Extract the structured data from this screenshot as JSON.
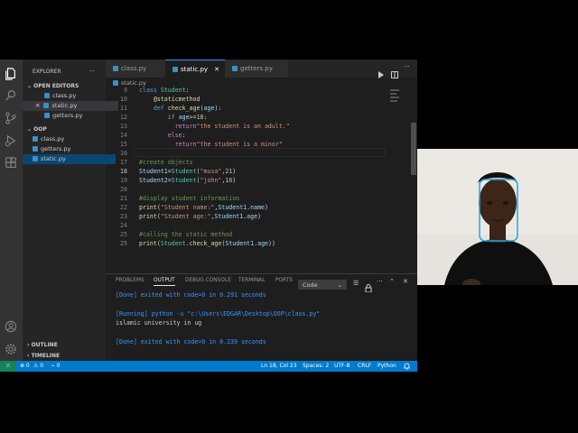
{
  "sidebar": {
    "title": "EXPLORER",
    "more": "···",
    "open_editors_title": "OPEN EDITORS",
    "open_editors": [
      "class.py",
      "static.py",
      "getters.py"
    ],
    "close_glyph": "✕",
    "folder_title": "OOP",
    "files": [
      "class.py",
      "getters.py",
      "static.py"
    ],
    "outline_title": "OUTLINE",
    "timeline_title": "TIMELINE"
  },
  "tabs": [
    "class.py",
    "static.py",
    "getters.py"
  ],
  "breadcrumb": "static.py",
  "editor": {
    "line_numbers": [
      "9",
      "10",
      "11",
      "12",
      "13",
      "14",
      "15",
      "16",
      "17",
      "18",
      "19",
      "20",
      "21",
      "22",
      "23",
      "24",
      "25"
    ],
    "current_line": "18"
  },
  "panel": {
    "tabs": [
      "PROBLEMS",
      "OUTPUT",
      "DEBUG CONSOLE",
      "TERMINAL",
      "PORTS"
    ],
    "select_value": "Code",
    "output_lines": [
      "[Done] exited with code=0 in 0.291 seconds",
      "",
      "[Running] python -u \"c:\\Users\\EDGAR\\Desktop\\OOP\\class.py\"",
      "islamic university in ug",
      "",
      "[Done] exited with code=0 in 0.239 seconds"
    ]
  },
  "status": {
    "errors": "⊗ 0",
    "warnings": "⚠ 0",
    "ports": "0",
    "position": "Ln 18, Col 23",
    "spaces": "Spaces: 2",
    "encoding": "UTF-8",
    "eol": "CRLF",
    "language": "Python"
  },
  "colors": {
    "accent": "#007acc",
    "activity_bar": "#333333",
    "sidebar": "#252526",
    "editor": "#1e1e1e"
  }
}
